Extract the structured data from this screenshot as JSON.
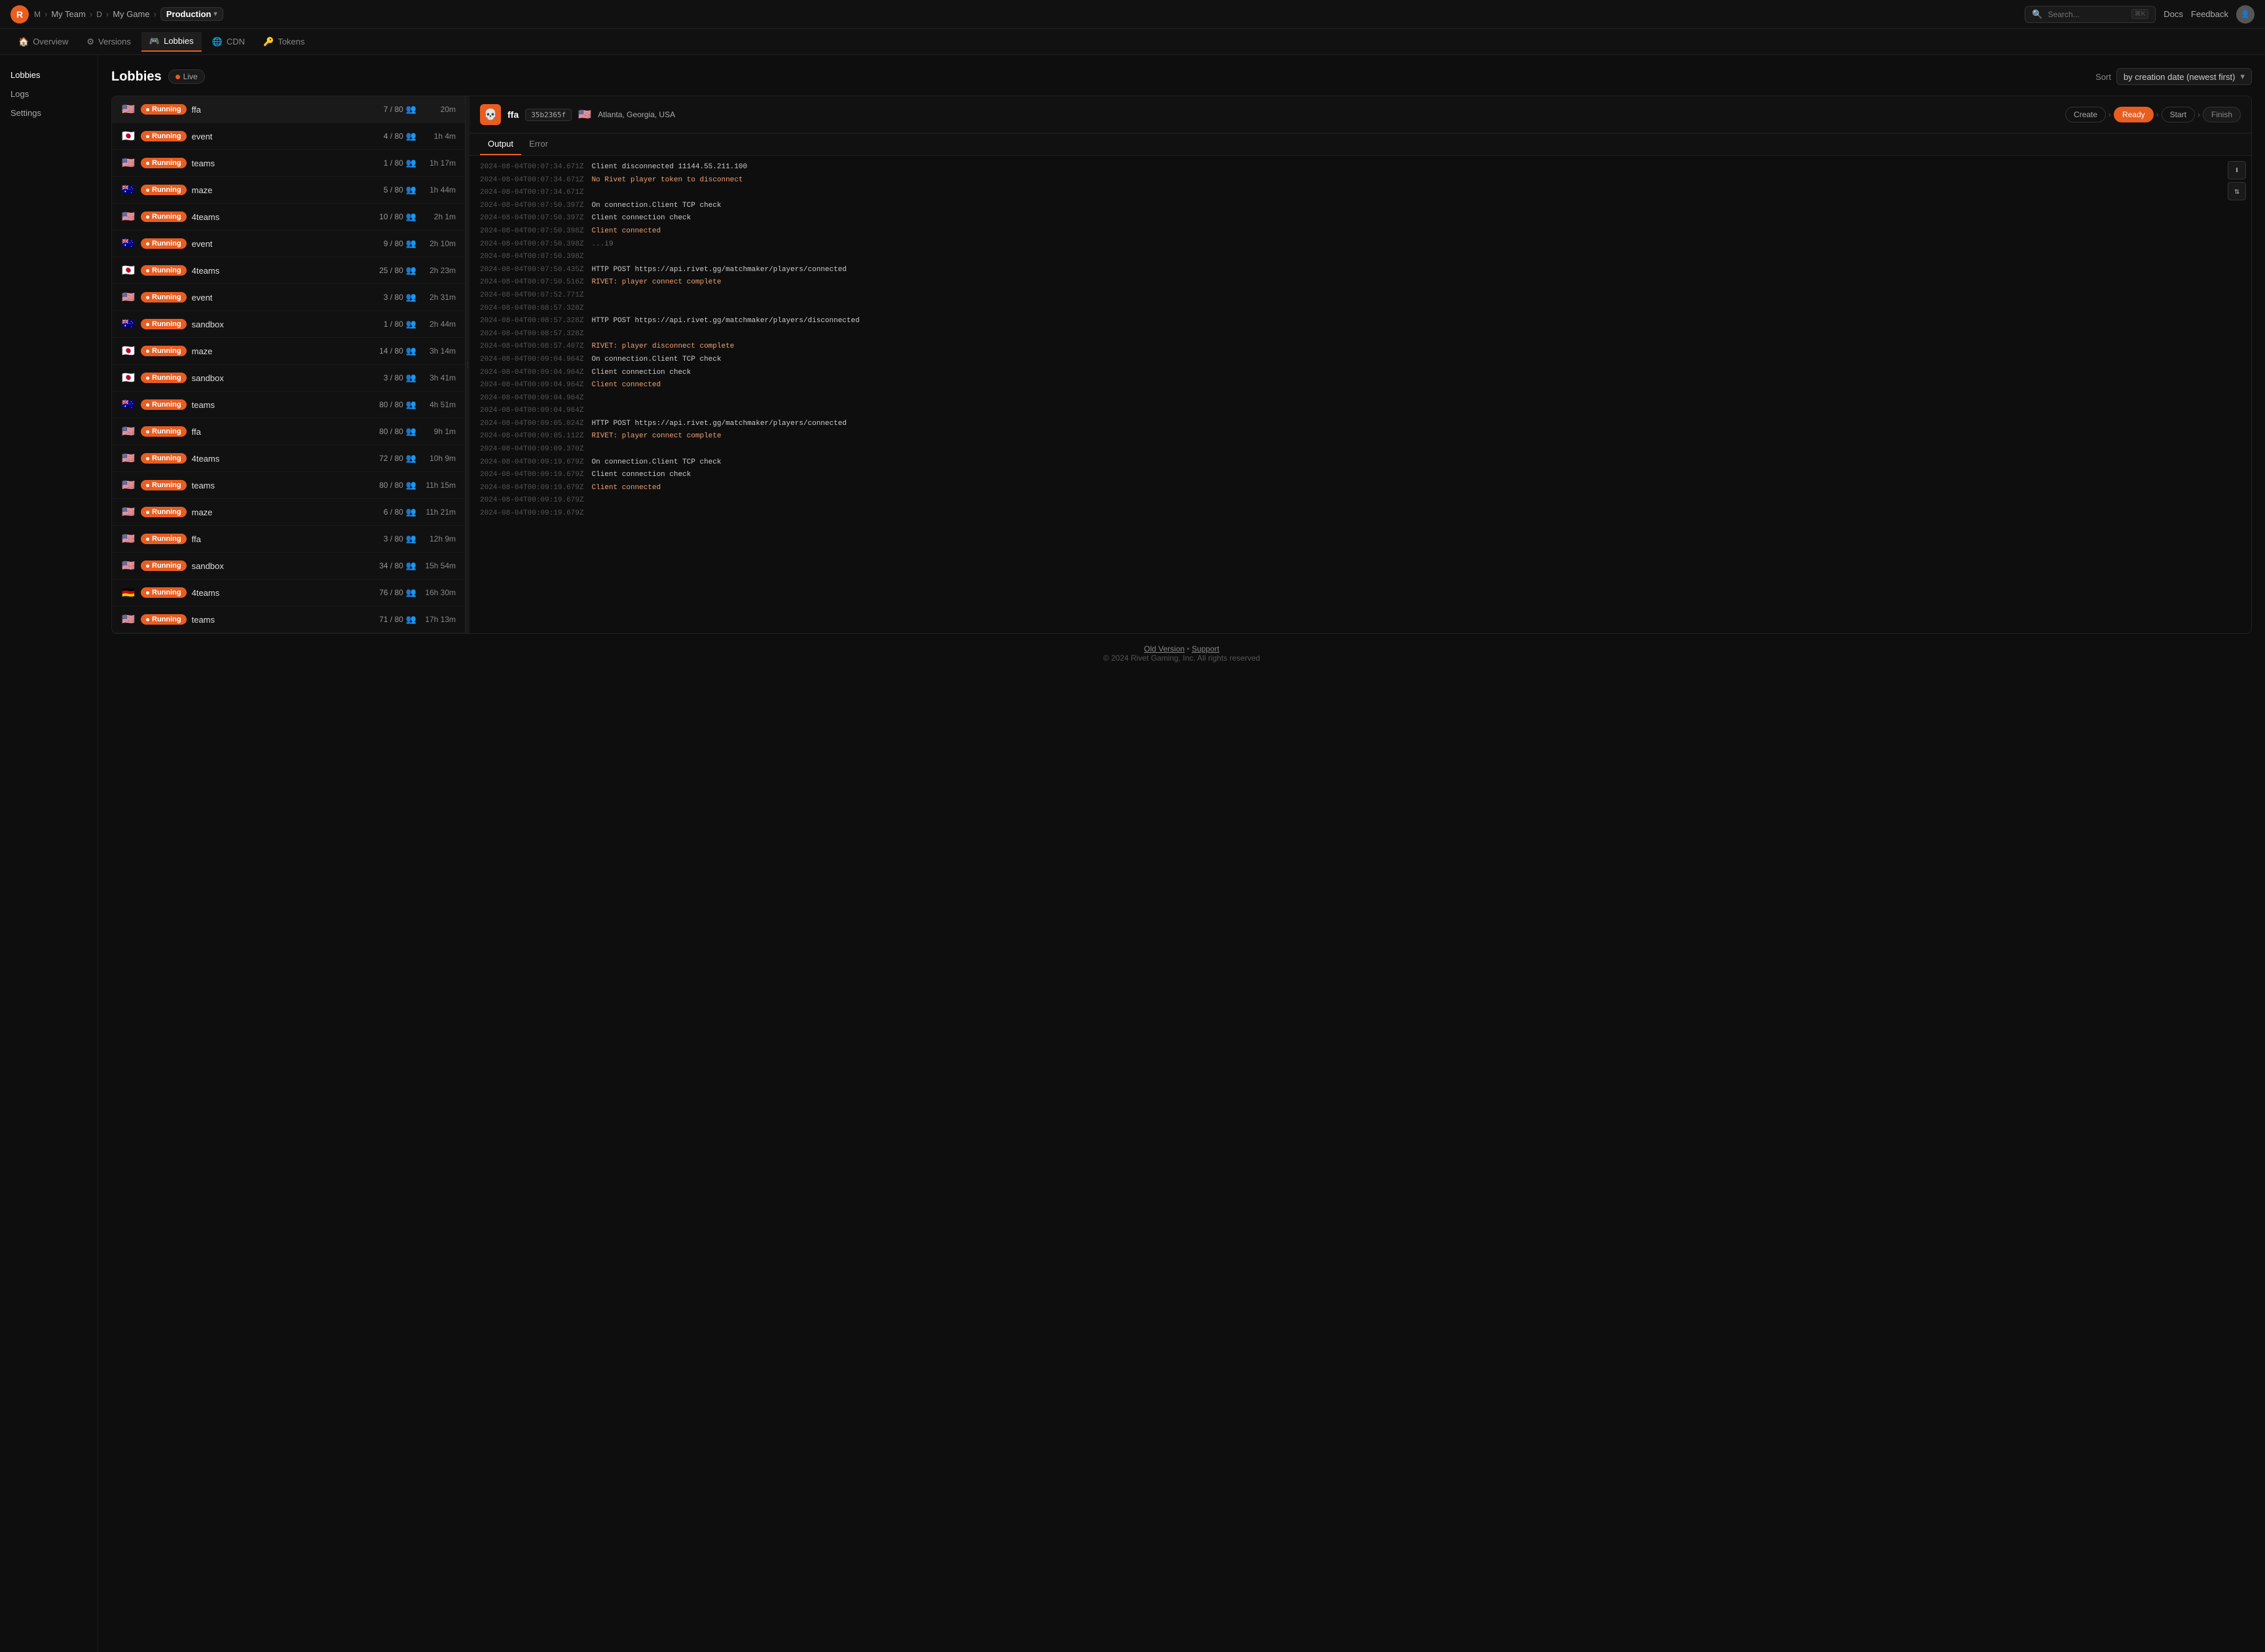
{
  "topNav": {
    "logo": "R",
    "breadcrumbs": [
      {
        "label": "M",
        "sep": false
      },
      {
        "label": "My Team",
        "sep": true
      },
      {
        "label": "D",
        "sep": false
      },
      {
        "label": "My Game",
        "sep": true
      }
    ],
    "current": "Production",
    "searchPlaceholder": "Search...",
    "searchShortcut": "⌘K",
    "docsLabel": "Docs",
    "feedbackLabel": "Feedback"
  },
  "subNav": {
    "items": [
      {
        "label": "Overview",
        "icon": "🏠",
        "active": false
      },
      {
        "label": "Versions",
        "icon": "⚙",
        "active": false
      },
      {
        "label": "Lobbies",
        "icon": "🎮",
        "active": true
      },
      {
        "label": "CDN",
        "icon": "🌐",
        "active": false
      },
      {
        "label": "Tokens",
        "icon": "🔑",
        "active": false
      }
    ]
  },
  "sidebar": {
    "items": [
      {
        "label": "Lobbies",
        "active": true
      },
      {
        "label": "Logs",
        "active": false
      },
      {
        "label": "Settings",
        "active": false
      }
    ]
  },
  "page": {
    "title": "Lobbies",
    "liveBadge": "Live",
    "sortLabel": "Sort",
    "sortValue": "by creation date (newest first)"
  },
  "lobbies": [
    {
      "flag": "🇺🇸",
      "status": "Running",
      "name": "ffa",
      "players": "7 / 80",
      "time": "20m",
      "selected": true
    },
    {
      "flag": "🇯🇵",
      "status": "Running",
      "name": "event",
      "players": "4 / 80",
      "time": "1h 4m",
      "selected": false
    },
    {
      "flag": "🇺🇸",
      "status": "Running",
      "name": "teams",
      "players": "1 / 80",
      "time": "1h 17m",
      "selected": false
    },
    {
      "flag": "🇦🇺",
      "status": "Running",
      "name": "maze",
      "players": "5 / 80",
      "time": "1h 44m",
      "selected": false
    },
    {
      "flag": "🇺🇸",
      "status": "Running",
      "name": "4teams",
      "players": "10 / 80",
      "time": "2h 1m",
      "selected": false
    },
    {
      "flag": "🇦🇺",
      "status": "Running",
      "name": "event",
      "players": "9 / 80",
      "time": "2h 10m",
      "selected": false
    },
    {
      "flag": "🇯🇵",
      "status": "Running",
      "name": "4teams",
      "players": "25 / 80",
      "time": "2h 23m",
      "selected": false
    },
    {
      "flag": "🇺🇸",
      "status": "Running",
      "name": "event",
      "players": "3 / 80",
      "time": "2h 31m",
      "selected": false
    },
    {
      "flag": "🇦🇺",
      "status": "Running",
      "name": "sandbox",
      "players": "1 / 80",
      "time": "2h 44m",
      "selected": false
    },
    {
      "flag": "🇯🇵",
      "status": "Running",
      "name": "maze",
      "players": "14 / 80",
      "time": "3h 14m",
      "selected": false
    },
    {
      "flag": "🇯🇵",
      "status": "Running",
      "name": "sandbox",
      "players": "3 / 80",
      "time": "3h 41m",
      "selected": false
    },
    {
      "flag": "🇦🇺",
      "status": "Running",
      "name": "teams",
      "players": "80 / 80",
      "time": "4h 51m",
      "selected": false
    },
    {
      "flag": "🇺🇸",
      "status": "Running",
      "name": "ffa",
      "players": "80 / 80",
      "time": "9h 1m",
      "selected": false
    },
    {
      "flag": "🇺🇸",
      "status": "Running",
      "name": "4teams",
      "players": "72 / 80",
      "time": "10h 9m",
      "selected": false
    },
    {
      "flag": "🇺🇸",
      "status": "Running",
      "name": "teams",
      "players": "80 / 80",
      "time": "11h 15m",
      "selected": false
    },
    {
      "flag": "🇺🇸",
      "status": "Running",
      "name": "maze",
      "players": "6 / 80",
      "time": "11h 21m",
      "selected": false
    },
    {
      "flag": "🇺🇸",
      "status": "Running",
      "name": "ffa",
      "players": "3 / 80",
      "time": "12h 9m",
      "selected": false
    },
    {
      "flag": "🇺🇸",
      "status": "Running",
      "name": "sandbox",
      "players": "34 / 80",
      "time": "15h 54m",
      "selected": false
    },
    {
      "flag": "🇩🇪",
      "status": "Running",
      "name": "4teams",
      "players": "76 / 80",
      "time": "16h 30m",
      "selected": false
    },
    {
      "flag": "🇺🇸",
      "status": "Running",
      "name": "teams",
      "players": "71 / 80",
      "time": "17h 13m",
      "selected": false
    }
  ],
  "detail": {
    "lobbyName": "ffa",
    "lobbyId": "35b2365f",
    "flagEmoji": "🇺🇸",
    "region": "Atlanta, Georgia, USA",
    "pipeline": [
      {
        "label": "Create",
        "state": "done"
      },
      {
        "label": "Ready",
        "state": "active"
      },
      {
        "label": "Start",
        "state": "done"
      },
      {
        "label": "Finish",
        "state": "default"
      }
    ],
    "tabs": [
      {
        "label": "Output",
        "active": true
      },
      {
        "label": "Error",
        "active": false
      }
    ],
    "logs": [
      {
        "ts": "2024-08-04T00:07:34.671Z",
        "msg": "Client disconnected 11144.55.211.100",
        "type": "normal"
      },
      {
        "ts": "2024-08-04T00:07:34.671Z",
        "msg": "No Rivet player token to disconnect",
        "type": "highlight"
      },
      {
        "ts": "2024-08-04T00:07:34.671Z",
        "msg": "",
        "type": "dim"
      },
      {
        "ts": "2024-08-04T00:07:50.397Z",
        "msg": "On connection.Client TCP check",
        "type": "normal"
      },
      {
        "ts": "2024-08-04T00:07:50.397Z",
        "msg": "Client connection check",
        "type": "normal"
      },
      {
        "ts": "2024-08-04T00:07:50.398Z",
        "msg": "Client connected",
        "type": "highlight"
      },
      {
        "ts": "2024-08-04T00:07:50.398Z",
        "msg": "...i9",
        "type": "dim"
      },
      {
        "ts": "2024-08-04T00:07:50.398Z",
        "msg": "",
        "type": "dim"
      },
      {
        "ts": "2024-08-04T00:07:50.435Z",
        "msg": "HTTP POST https://api.rivet.gg/matchmaker/players/connected",
        "type": "normal"
      },
      {
        "ts": "2024-08-04T00:07:50.516Z",
        "msg": "RIVET: player connect complete",
        "type": "highlight"
      },
      {
        "ts": "2024-08-04T00:07:52.771Z",
        "msg": "",
        "type": "dim"
      },
      {
        "ts": "2024-08-04T00:08:57.328Z",
        "msg": "",
        "type": "dim"
      },
      {
        "ts": "2024-08-04T00:08:57.328Z",
        "msg": "HTTP POST https://api.rivet.gg/matchmaker/players/disconnected",
        "type": "normal"
      },
      {
        "ts": "2024-08-04T00:08:57.328Z",
        "msg": "",
        "type": "dim"
      },
      {
        "ts": "2024-08-04T00:08:57.407Z",
        "msg": "RIVET: player disconnect complete",
        "type": "highlight"
      },
      {
        "ts": "2024-08-04T00:09:04.964Z",
        "msg": "On connection.Client TCP check",
        "type": "normal"
      },
      {
        "ts": "2024-08-04T00:09:04.964Z",
        "msg": "Client connection check",
        "type": "normal"
      },
      {
        "ts": "2024-08-04T00:09:04.964Z",
        "msg": "Client connected",
        "type": "highlight"
      },
      {
        "ts": "2024-08-04T00:09:04.964Z",
        "msg": "",
        "type": "dim"
      },
      {
        "ts": "2024-08-04T00:09:04.964Z",
        "msg": "",
        "type": "dim"
      },
      {
        "ts": "2024-08-04T00:09:05.024Z",
        "msg": "HTTP POST https://api.rivet.gg/matchmaker/players/connected",
        "type": "normal"
      },
      {
        "ts": "2024-08-04T00:09:05.112Z",
        "msg": "RIVET: player connect complete",
        "type": "highlight"
      },
      {
        "ts": "2024-08-04T00:09:09.370Z",
        "msg": "",
        "type": "dim"
      },
      {
        "ts": "2024-08-04T00:09:19.679Z",
        "msg": "On connection.Client TCP check",
        "type": "normal"
      },
      {
        "ts": "2024-08-04T00:09:19.679Z",
        "msg": "Client connection check",
        "type": "normal"
      },
      {
        "ts": "2024-08-04T00:09:19.679Z",
        "msg": "Client connected",
        "type": "highlight"
      },
      {
        "ts": "2024-08-04T00:09:19.679Z",
        "msg": "",
        "type": "dim"
      },
      {
        "ts": "2024-08-04T00:09:19.679Z",
        "msg": "",
        "type": "dim"
      }
    ]
  },
  "footer": {
    "oldVersionLabel": "Old Version",
    "separator": "•",
    "supportLabel": "Support",
    "copyright": "© 2024 Rivet Gaming, Inc. All rights reserved"
  }
}
